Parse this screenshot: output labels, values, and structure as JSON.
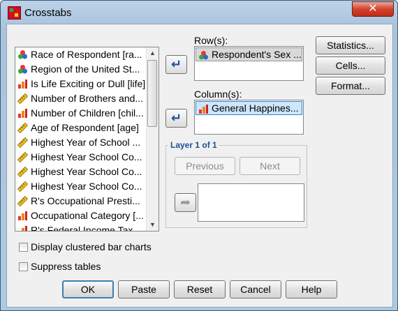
{
  "window": {
    "title": "Crosstabs",
    "close_glyph": "✕"
  },
  "variables": [
    {
      "label": "Race of Respondent [ra...",
      "icon": "nominal"
    },
    {
      "label": "Region of the United St...",
      "icon": "nominal"
    },
    {
      "label": "Is Life Exciting or Dull [life]",
      "icon": "ordinal"
    },
    {
      "label": "Number of Brothers and...",
      "icon": "scale"
    },
    {
      "label": "Number of Children [chil...",
      "icon": "ordinal"
    },
    {
      "label": "Age of Respondent [age]",
      "icon": "scale"
    },
    {
      "label": "Highest Year of School ...",
      "icon": "scale"
    },
    {
      "label": "Highest Year School Co...",
      "icon": "scale"
    },
    {
      "label": "Highest Year School Co...",
      "icon": "scale"
    },
    {
      "label": "Highest Year School Co...",
      "icon": "scale"
    },
    {
      "label": "R's Occupational Presti...",
      "icon": "scale"
    },
    {
      "label": "Occupational Category [...",
      "icon": "ordinal"
    },
    {
      "label": "R's Federal Income Tax...",
      "icon": "ordinal"
    }
  ],
  "rows": {
    "label": "Row(s):",
    "value": "Respondent's Sex ...",
    "icon": "nominal"
  },
  "columns": {
    "label": "Column(s):",
    "value": "General Happines...",
    "icon": "ordinal"
  },
  "layer": {
    "title": "Layer 1 of 1",
    "previous": "Previous",
    "next": "Next"
  },
  "side_buttons": {
    "statistics": "Statistics...",
    "cells": "Cells...",
    "format": "Format..."
  },
  "options": {
    "clustered": "Display clustered bar charts",
    "suppress": "Suppress tables"
  },
  "footer": {
    "ok": "OK",
    "paste": "Paste",
    "reset": "Reset",
    "cancel": "Cancel",
    "help": "Help"
  },
  "arrows": {
    "move": "↵",
    "disabled": "➦"
  }
}
